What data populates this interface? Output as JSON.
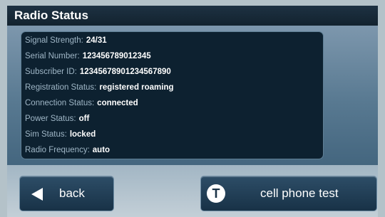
{
  "title": "Radio Status",
  "status_rows": [
    {
      "label": "Signal Strength:",
      "value": "24/31"
    },
    {
      "label": "Serial Number:",
      "value": "123456789012345"
    },
    {
      "label": "Subscriber ID:",
      "value": "12345678901234567890"
    },
    {
      "label": "Registration Status:",
      "value": "registered roaming"
    },
    {
      "label": "Connection Status:",
      "value": "connected"
    },
    {
      "label": "Power Status:",
      "value": "off"
    },
    {
      "label": "Sim Status:",
      "value": "locked"
    },
    {
      "label": "Radio Frequency:",
      "value": "auto"
    }
  ],
  "buttons": {
    "back": {
      "label": "back",
      "icon": "left-arrow-icon"
    },
    "cell_phone_test": {
      "label": "cell phone test",
      "icon_letter": "T",
      "icon": "t-circle-icon"
    }
  },
  "colors": {
    "title_bar": "#1d3142",
    "panel_bg": "#0d2130",
    "label_text": "#9fb6c6",
    "value_text": "#ffffff",
    "button_bg": "#1e3a52"
  }
}
